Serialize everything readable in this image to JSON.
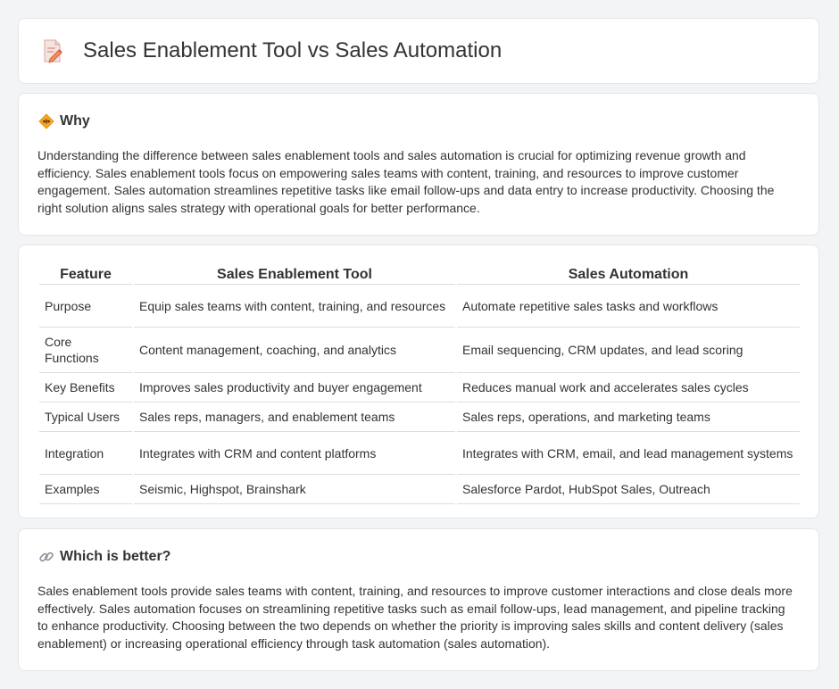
{
  "header": {
    "title": "Sales Enablement Tool vs Sales Automation",
    "icon": "document-pencil-icon"
  },
  "why": {
    "heading": "Why",
    "icon": "diamond-sign-icon",
    "body": "Understanding the difference between sales enablement tools and sales automation is crucial for optimizing revenue growth and efficiency. Sales enablement tools focus on empowering sales teams with content, training, and resources to improve customer engagement. Sales automation streamlines repetitive tasks like email follow-ups and data entry to increase productivity. Choosing the right solution aligns sales strategy with operational goals for better performance."
  },
  "table": {
    "headers": [
      "Feature",
      "Sales Enablement Tool",
      "Sales Automation"
    ],
    "rows": [
      [
        "Purpose",
        "Equip sales teams with content, training, and resources",
        "Automate repetitive sales tasks and workflows"
      ],
      [
        "Core Functions",
        "Content management, coaching, and analytics",
        "Email sequencing, CRM updates, and lead scoring"
      ],
      [
        "Key Benefits",
        "Improves sales productivity and buyer engagement",
        "Reduces manual work and accelerates sales cycles"
      ],
      [
        "Typical Users",
        "Sales reps, managers, and enablement teams",
        "Sales reps, operations, and marketing teams"
      ],
      [
        "Integration",
        "Integrates with CRM and content platforms",
        "Integrates with CRM, email, and lead management systems"
      ],
      [
        "Examples",
        "Seismic, Highspot, Brainshark",
        "Salesforce Pardot, HubSpot Sales, Outreach"
      ]
    ]
  },
  "better": {
    "heading": "Which is better?",
    "icon": "link-icon",
    "body": "Sales enablement tools provide sales teams with content, training, and resources to improve customer interactions and close deals more effectively. Sales automation focuses on streamlining repetitive tasks such as email follow-ups, lead management, and pipeline tracking to enhance productivity. Choosing between the two depends on whether the priority is improving sales skills and content delivery (sales enablement) or increasing operational efficiency through task automation (sales automation)."
  }
}
